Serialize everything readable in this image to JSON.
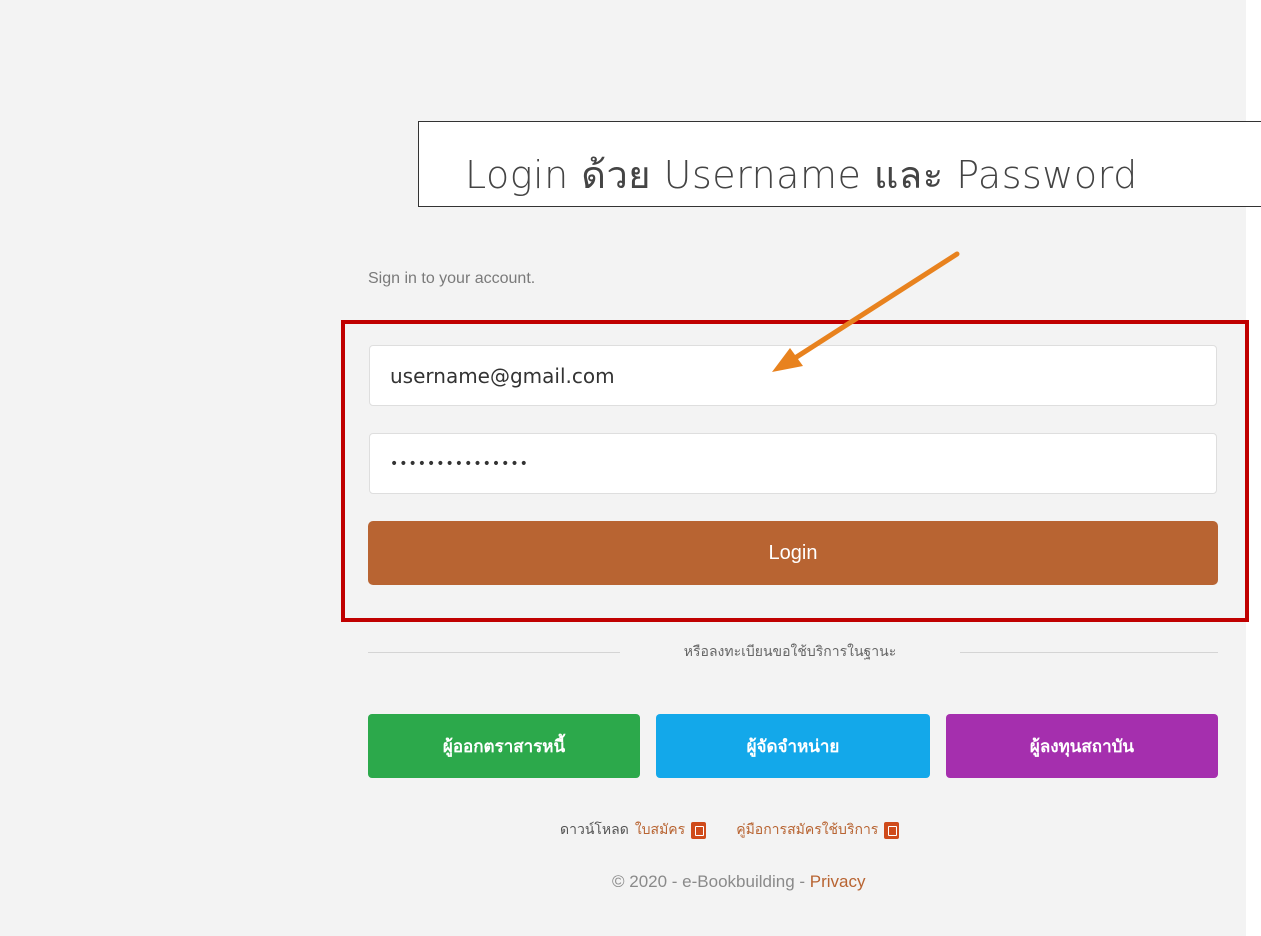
{
  "annotation": {
    "callout_text": "Login ด้วย Username และ Password"
  },
  "login_form": {
    "subtitle": "Sign in to your account.",
    "username_value": "username@gmail.com",
    "password_value": "•••••••••••••••",
    "login_label": "Login"
  },
  "register": {
    "divider_label": "หรือลงทะเบียนขอใช้บริการในฐานะ",
    "buttons": [
      {
        "label": "ผู้ออกตราสารหนี้",
        "color": "#2ca94b"
      },
      {
        "label": "ผู้จัดจำหน่าย",
        "color": "#13a8ea"
      },
      {
        "label": "ผู้ลงทุนสถาบัน",
        "color": "#a52fae"
      }
    ]
  },
  "downloads": {
    "prefix": "ดาวน์โหลด",
    "application_form": "ใบสมัคร",
    "manual": "คู่มือการสมัครใช้บริการ",
    "icon": "pdf-icon"
  },
  "footer": {
    "copyright": "© 2020 - e-Bookbuilding - ",
    "privacy": "Privacy"
  },
  "colors": {
    "accent": "#b86432",
    "highlight": "#c00000",
    "arrow": "#e8821e"
  }
}
